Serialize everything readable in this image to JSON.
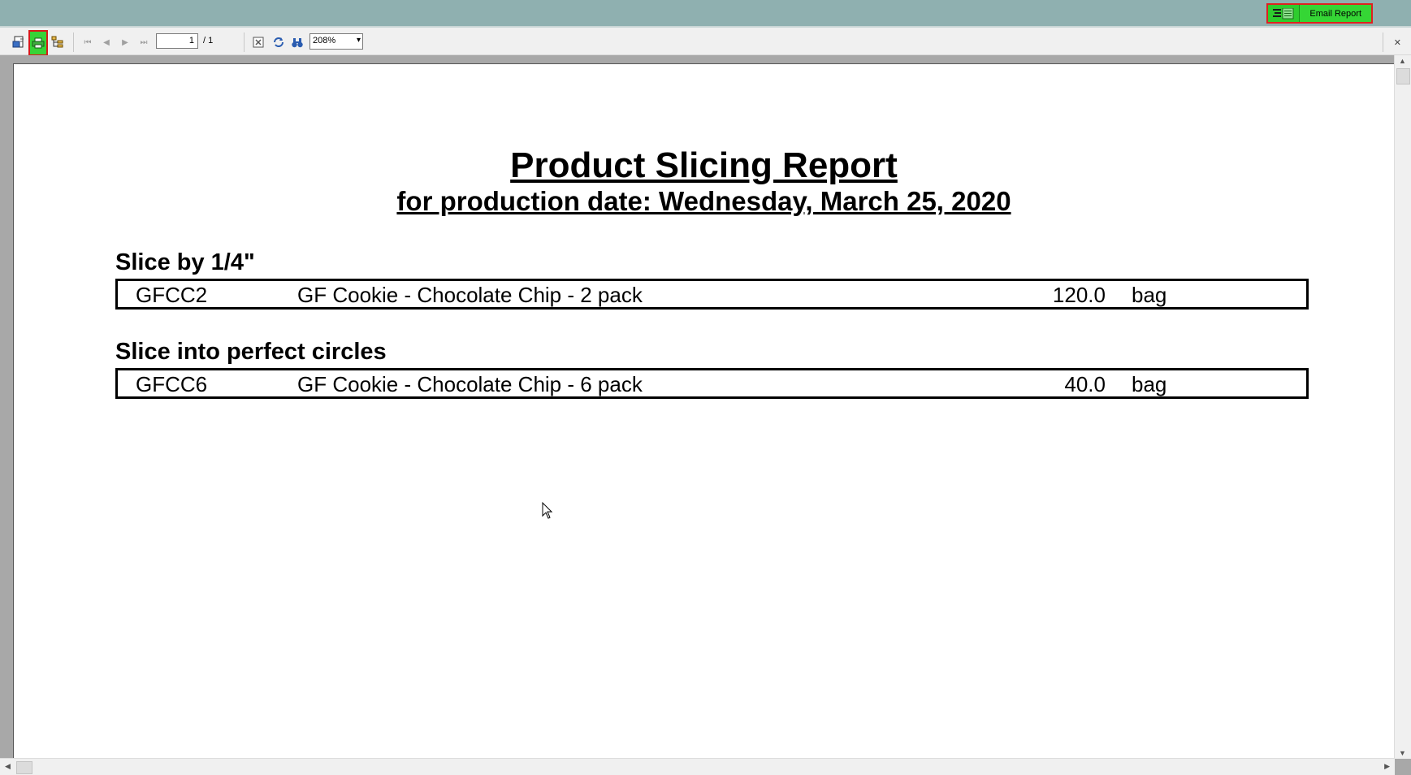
{
  "topbar": {
    "email_label": "Email Report"
  },
  "toolbar": {
    "page_current": "1",
    "page_total": "/ 1",
    "zoom": "208%"
  },
  "report": {
    "title": "Product Slicing Report",
    "subtitle": "for production date: Wednesday, March 25, 2020",
    "groups": [
      {
        "heading": "Slice by 1/4\"",
        "item": {
          "code": "GFCC2",
          "description": "GF Cookie - Chocolate Chip - 2 pack",
          "quantity": "120.0",
          "unit": "bag"
        }
      },
      {
        "heading": "Slice into perfect circles",
        "item": {
          "code": "GFCC6",
          "description": "GF Cookie - Chocolate Chip - 6 pack",
          "quantity": "40.0",
          "unit": "bag"
        }
      }
    ]
  },
  "colors": {
    "topbar": "#8fb0b0",
    "highlight_green": "#2ecc2e",
    "highlight_border": "#e02020"
  }
}
